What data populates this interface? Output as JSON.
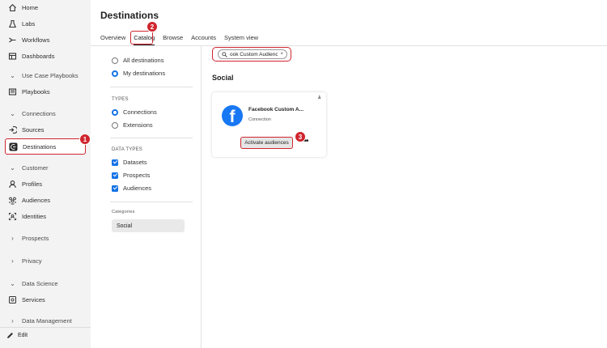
{
  "sidebar": {
    "items": [
      {
        "label": "Home",
        "icon": "home-icon",
        "type": "link"
      },
      {
        "label": "Labs",
        "icon": "flask-icon",
        "type": "link"
      },
      {
        "label": "Workflows",
        "icon": "workflow-icon",
        "type": "link"
      },
      {
        "label": "Dashboards",
        "icon": "dashboard-icon",
        "type": "link"
      },
      {
        "label": "Use Case Playbooks",
        "icon": "chevron-down-icon",
        "type": "section"
      },
      {
        "label": "Playbooks",
        "icon": "playbook-icon",
        "type": "link"
      },
      {
        "label": "Connections",
        "icon": "chevron-down-icon",
        "type": "section"
      },
      {
        "label": "Sources",
        "icon": "sources-icon",
        "type": "link"
      },
      {
        "label": "Destinations",
        "icon": "destinations-icon",
        "type": "link",
        "active": true
      },
      {
        "label": "Customer",
        "icon": "chevron-down-icon",
        "type": "section"
      },
      {
        "label": "Profiles",
        "icon": "profile-icon",
        "type": "link"
      },
      {
        "label": "Audiences",
        "icon": "audiences-icon",
        "type": "link"
      },
      {
        "label": "Identities",
        "icon": "identities-icon",
        "type": "link"
      },
      {
        "label": "Prospects",
        "icon": "chevron-right-icon",
        "type": "section"
      },
      {
        "label": "Privacy",
        "icon": "chevron-right-icon",
        "type": "section"
      },
      {
        "label": "Data Science",
        "icon": "chevron-down-icon",
        "type": "section"
      },
      {
        "label": "Services",
        "icon": "services-icon",
        "type": "link"
      },
      {
        "label": "Data Management",
        "icon": "chevron-right-icon",
        "type": "section"
      }
    ],
    "edit_label": "Edit"
  },
  "header": {
    "title": "Destinations",
    "tabs": [
      "Overview",
      "Catalog",
      "Browse",
      "Accounts",
      "System view"
    ],
    "selected_tab": "Catalog"
  },
  "filters": {
    "scope": [
      "All destinations",
      "My destinations"
    ],
    "scope_selected": "My destinations",
    "types_title": "TYPES",
    "types": [
      "Connections",
      "Extensions"
    ],
    "types_selected": "Connections",
    "data_types_title": "DATA TYPES",
    "data_types": [
      "Datasets",
      "Prospects",
      "Audiences"
    ],
    "categories_title": "Categories",
    "category_selected": "Social"
  },
  "search": {
    "value": "ook Custom Audience",
    "clear": "×"
  },
  "section_title": "Social",
  "card": {
    "title": "Facebook Custom A...",
    "subtitle": "Connection",
    "action_label": "Activate audiences",
    "more": "•••"
  },
  "callouts": [
    "1",
    "2",
    "3"
  ],
  "colors": {
    "accent": "#1473e6",
    "callout": "#d0252e",
    "facebook": "#1877f2"
  }
}
